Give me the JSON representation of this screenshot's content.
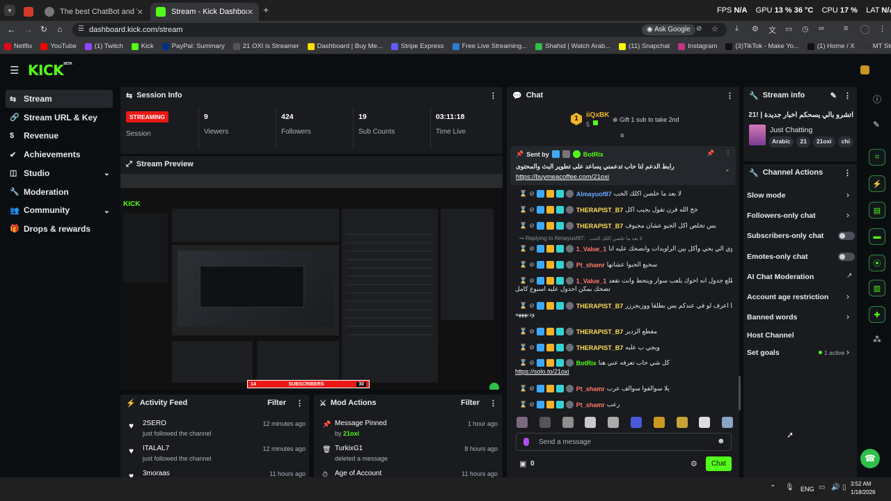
{
  "browser": {
    "tabs": [
      {
        "label": "The best ChatBot and Widg"
      },
      {
        "label": "Stream - Kick Dashboard"
      }
    ],
    "url": "dashboard.kick.com/stream",
    "ask_google": "Ask Google",
    "perf": {
      "fps_label": "FPS",
      "fps": "N/A",
      "gpu_label": "GPU",
      "gpu": "13 %",
      "gpu_temp": "36 °C",
      "cpu_label": "CPU",
      "cpu": "17 %",
      "lat_label": "LAT",
      "lat": "N/A"
    },
    "bookmarks": [
      "Netflix",
      "YouTube",
      "(1) Twitch",
      "Kick",
      "PayPal: Summary",
      "21 OXI is Streamer",
      "Dashboard | Buy Me...",
      "Stripe Express",
      "Free Live Streaming...",
      "Shahid | Watch Arab...",
      "(11) Snapchat",
      "Instagram",
      "(3)TikTok - Make Yo...",
      "(1) Home / X",
      "MT Store - مرحبًا"
    ]
  },
  "app": {
    "logo": "KICK",
    "logo_sup": "BETA",
    "nav": [
      {
        "label": "Stream",
        "icon": "signal-icon"
      },
      {
        "label": "Stream URL & Key",
        "icon": "link-icon"
      },
      {
        "label": "Revenue",
        "icon": "dollar-icon"
      },
      {
        "label": "Achievements",
        "icon": "check-badge-icon"
      },
      {
        "label": "Studio",
        "icon": "layers-icon"
      },
      {
        "label": "Moderation",
        "icon": "wrench-icon"
      },
      {
        "label": "Community",
        "icon": "users-icon"
      },
      {
        "label": "Drops & rewards",
        "icon": "gift-icon"
      }
    ]
  },
  "session": {
    "title": "Session Info",
    "status": "STREAMING",
    "stats": [
      {
        "value": "",
        "label": "Session"
      },
      {
        "value": "9",
        "label": "Viewers"
      },
      {
        "value": "424",
        "label": "Followers"
      },
      {
        "value": "19",
        "label": "Sub Counts"
      },
      {
        "value": "03:11:18",
        "label": "Time Live"
      }
    ]
  },
  "preview": {
    "title": "Stream Preview"
  },
  "overlay": {
    "left": "14",
    "label": "SUBSCRIBERS",
    "right": "30"
  },
  "activity": {
    "title": "Activity Feed",
    "filter": "Filter",
    "items": [
      {
        "name": "2SERO",
        "action": "just followed the channel",
        "time": "12 minutes ago"
      },
      {
        "name": "ITALAL7",
        "action": "just followed the channel",
        "time": "12 minutes ago"
      },
      {
        "name": "3moraas",
        "action": "",
        "time": "11 hours ago"
      }
    ]
  },
  "mod_actions": {
    "title": "Mod Actions",
    "filter": "Filter",
    "items": [
      {
        "title": "Message Pinned",
        "by_prefix": "by",
        "by": "21oxi",
        "time": "1 hour ago"
      },
      {
        "title": "TurkixG1",
        "sub": "deleted a message",
        "time": "8 hours ago"
      },
      {
        "title": "Age of Account",
        "sub": "",
        "time": "11 hours ago"
      }
    ]
  },
  "chat": {
    "title": "Chat",
    "gifter": {
      "name": "iiQxBK",
      "count": "5",
      "rank": "1",
      "gift_text": "Gift 1 sub to take 2nd"
    },
    "pinned": {
      "sent_by": "Sent by",
      "user": "BotRix",
      "text": "رابط الدعم لنا حاب تدعمني يساعد على تطوير البث والمحتوى",
      "link": "https://buymeacoffee.com/21oxi"
    },
    "messages": [
      {
        "user": "Almayuof87",
        "color": "#6da7ff",
        "text": "لا بعد ما خلصن اكلك الحب"
      },
      {
        "user": "THERAPIST_B7",
        "color": "#ffdd55",
        "text": "خخ الله فرن تقول يجيب اكل"
      },
      {
        "user": "THERAPIST_B7",
        "color": "#ffdd55",
        "text": "بس تخلص اكل الجيو عشان مجيوف"
      },
      {
        "reply": "Replying to Almayuof87:",
        "reply_text": "لا بعد ما خلصن اكلك الحب"
      },
      {
        "user": "1_Value_1",
        "color": "#ff7a6b",
        "text": "تكرت اخوي الي بحي وأكل بين الراويدات وانصحك عليه انا"
      },
      {
        "user": "Pt_shamr",
        "color": "#ff7a6b",
        "text": "سحبع الحبوا عشانها"
      },
      {
        "user": "1_Value_1",
        "color": "#ff7a6b",
        "text": "قسم بالله اطلع جدول انه اخوك بلعب سوار ويتحط وانت تقعد",
        "text2": "تضحك بمكن اجدول عليه اسبوع كامل"
      },
      {
        "user": "THERAPIST_B7",
        "color": "#ffdd55",
        "text": "ما اعرف لو في عندكم بس بطلقا ووزبجرزر",
        "text2": "ودبهههه"
      },
      {
        "user": "THERAPIST_B7",
        "color": "#ffdd55",
        "text": "مقطع الزدير"
      },
      {
        "user": "THERAPIST_B7",
        "color": "#ffdd55",
        "text": "ويجي ب علبه"
      },
      {
        "user": "BotRix",
        "color": "#53fc18",
        "text": "كل شي حاب تعرفه عني هنا",
        "link": "https://solo.to/21oxi"
      },
      {
        "user": "Pt_shamr",
        "color": "#ff7a6b",
        "text": "يلا سوالفوا سوالف عرب"
      },
      {
        "user": "Pt_shamr",
        "color": "#ff7a6b",
        "text": "رعب"
      }
    ],
    "input_placeholder": "Send a message",
    "points": "0",
    "send_label": "Chat"
  },
  "stream_info": {
    "title": "Stream info",
    "stream_title": "اتشرو بالي يسحكم اخبار جديدة | !21",
    "category": "Just Chatting",
    "tags": [
      "Arabic",
      "21",
      "21oxi",
      "chi"
    ]
  },
  "channel_actions": {
    "title": "Channel Actions",
    "items": [
      {
        "label": "Slow mode",
        "control": "chevron"
      },
      {
        "label": "Followers-only chat",
        "control": "chevron"
      },
      {
        "label": "Subscribers-only chat",
        "control": "toggle"
      },
      {
        "label": "Emotes-only chat",
        "control": "toggle"
      },
      {
        "label": "AI Chat Moderation",
        "control": "external"
      },
      {
        "label": "Account age restriction",
        "control": "chevron"
      },
      {
        "label": "Banned words",
        "control": "chevron"
      },
      {
        "label": "Host Channel",
        "control": "none"
      },
      {
        "label": "Set goals",
        "control": "chevron",
        "extra": "1 active"
      }
    ]
  },
  "taskbar": {
    "lang": "ENG",
    "time": "3:52 AM",
    "date": "1/18/2026"
  },
  "colors": {
    "accent": "#53fc18",
    "streaming": "#e91916",
    "panel": "#191b1f",
    "bg": "#0b0e11"
  }
}
